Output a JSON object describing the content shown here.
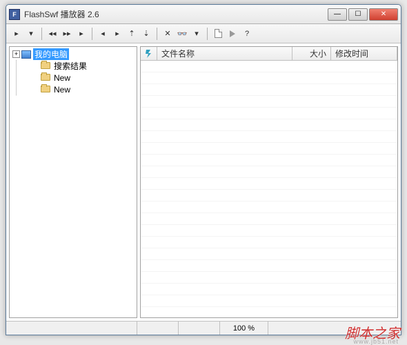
{
  "title": "FlashSwf 播放器 2.6",
  "toolbar": {
    "b1": "▸",
    "b2": "▾",
    "b3": "◂◂",
    "b4": "▸▸",
    "b5": "▸",
    "b6": "◂",
    "b7": "▸",
    "b8": "⇡",
    "b9": "⇣",
    "b10": "✕",
    "b11": "👓",
    "b12": "▾",
    "b14": "▶",
    "b15": "?"
  },
  "tree": {
    "root": "我的电脑",
    "items": [
      "搜索结果",
      "New",
      "New"
    ]
  },
  "columns": {
    "name": "文件名称",
    "size": "大小",
    "time": "修改时间"
  },
  "status": {
    "zoom": "100 %"
  },
  "watermark": "脚本之家",
  "watermark_sub": "www.jb51.net"
}
